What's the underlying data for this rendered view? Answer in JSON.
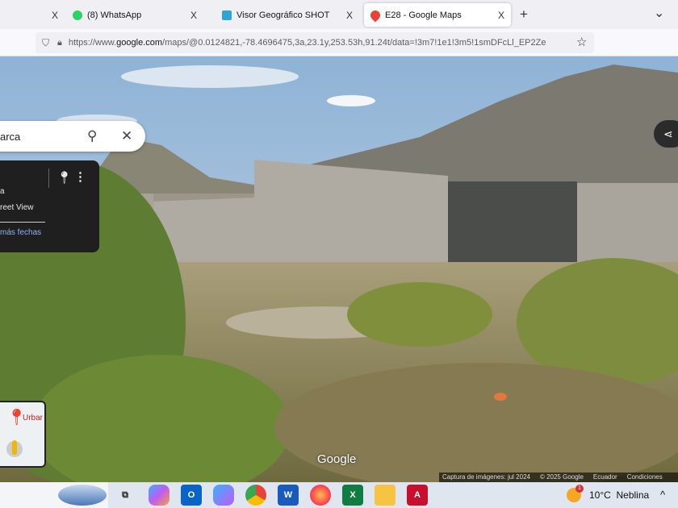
{
  "tabs": [
    {
      "label": "",
      "close": "X"
    },
    {
      "label": "(8) WhatsApp",
      "close": "X"
    },
    {
      "label": "Visor Geográfico SHOT",
      "close": "X"
    },
    {
      "label": "E28 - Google Maps",
      "close": "X",
      "active": true
    }
  ],
  "new_tab": "+",
  "tab_list": "⌄",
  "url": {
    "prefix": "https://www.",
    "domain": "google.com",
    "rest": "/maps/@0.0124821,-78.4696475,3a,23.1y,253.53h,91.24t/data=!3m7!1e1!3m5!1smDFcLl_EP2Ze"
  },
  "search": {
    "value": "arca"
  },
  "panel": {
    "line1": "a",
    "line2": "reet View",
    "link": "más fechas"
  },
  "minimap": {
    "label": "Urbar"
  },
  "google_logo": "Google",
  "attribution": [
    "Captura de imágenes: jul 2024",
    "© 2025 Google",
    "Ecuador",
    "Condiciones"
  ],
  "taskbar": {
    "weather_temp": "10°C",
    "weather_desc": "Neblina",
    "weather_badge": "1",
    "chevron": "^"
  }
}
